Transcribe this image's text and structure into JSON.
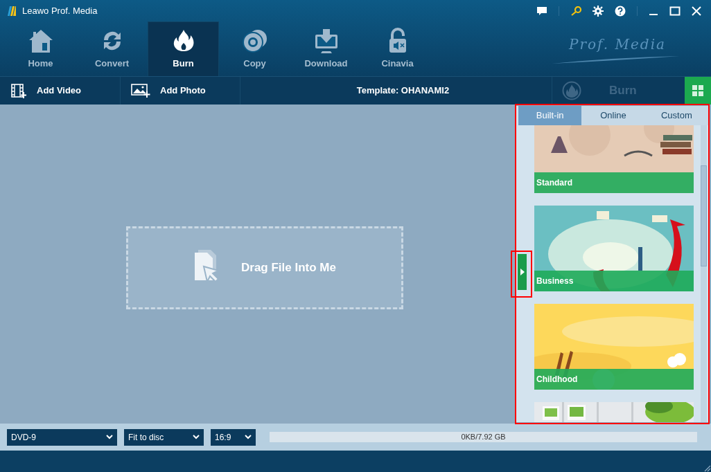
{
  "window": {
    "title": "Leawo Prof. Media"
  },
  "nav_tabs": [
    {
      "label": "Home",
      "selected": false
    },
    {
      "label": "Convert",
      "selected": false
    },
    {
      "label": "Burn",
      "selected": true
    },
    {
      "label": "Copy",
      "selected": false
    },
    {
      "label": "Download",
      "selected": false
    },
    {
      "label": "Cinavia",
      "selected": false
    }
  ],
  "brand_script": "Prof. Media",
  "toolbar": {
    "add_video": "Add Video",
    "add_photo": "Add Photo",
    "template": "Template: OHANAMI2",
    "burn": "Burn",
    "burn_disabled": true
  },
  "drop_zone": {
    "label": "Drag File Into Me"
  },
  "template_panel": {
    "tabs": [
      {
        "label": "Built-in",
        "selected": true
      },
      {
        "label": "Online",
        "selected": false
      },
      {
        "label": "Custom",
        "selected": false
      }
    ],
    "templates": [
      {
        "kind": "picture",
        "name": "Standard"
      },
      {
        "kind": "picture",
        "name": "Business"
      },
      {
        "kind": "picture",
        "name": "Childhood"
      },
      {
        "kind": "picture"
      }
    ]
  },
  "bottom_bar": {
    "disc_type": "DVD-9",
    "fit": "Fit to disc",
    "aspect": "16:9",
    "usage": "0KB/7.92 GB"
  }
}
